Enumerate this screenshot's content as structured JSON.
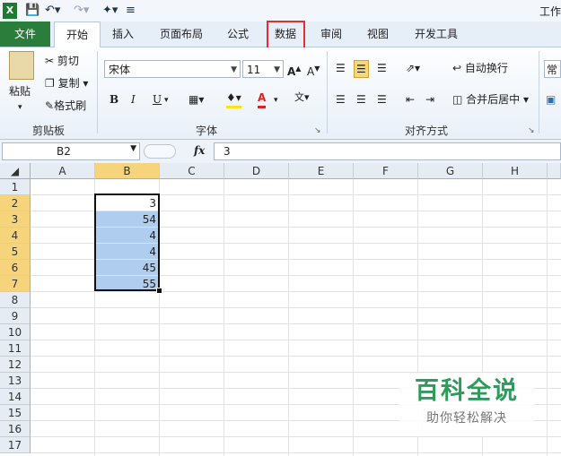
{
  "quick_access": {
    "undo_icon": "undo-icon",
    "redo_icon": "redo-icon"
  },
  "app_title": "工作",
  "tabs": {
    "file": "文件",
    "items": [
      {
        "label": "开始"
      },
      {
        "label": "插入"
      },
      {
        "label": "页面布局"
      },
      {
        "label": "公式"
      },
      {
        "label": "数据"
      },
      {
        "label": "审阅"
      },
      {
        "label": "视图"
      },
      {
        "label": "开发工具"
      }
    ]
  },
  "ribbon": {
    "clipboard": {
      "paste": "粘贴",
      "cut": "剪切",
      "copy": "复制",
      "format_painter": "格式刷",
      "group": "剪贴板"
    },
    "font": {
      "name": "宋体",
      "size": "11",
      "bold": "B",
      "italic": "I",
      "underline": "U",
      "group": "字体"
    },
    "align": {
      "wrap": "自动换行",
      "merge": "合并后居中",
      "group": "对齐方式"
    },
    "number": {
      "format": "常规"
    }
  },
  "formula_bar": {
    "cell_ref": "B2",
    "fx": "fx",
    "value": "3"
  },
  "columns": [
    "A",
    "B",
    "C",
    "D",
    "E",
    "F",
    "G",
    "H"
  ],
  "rows": [
    "1",
    "2",
    "3",
    "4",
    "5",
    "6",
    "7",
    "8",
    "9",
    "10",
    "11",
    "12",
    "13",
    "14",
    "15",
    "16",
    "17"
  ],
  "cells_b": [
    "3",
    "54",
    "4",
    "4",
    "45",
    "55"
  ],
  "watermark": {
    "title": "百科全说",
    "subtitle": "助你轻松解决"
  },
  "colors": {
    "file_tab": "#2a7d3a",
    "selection_fill": "#aecdef",
    "header_highlight": "#f6d47c",
    "callout": "#e03030"
  }
}
